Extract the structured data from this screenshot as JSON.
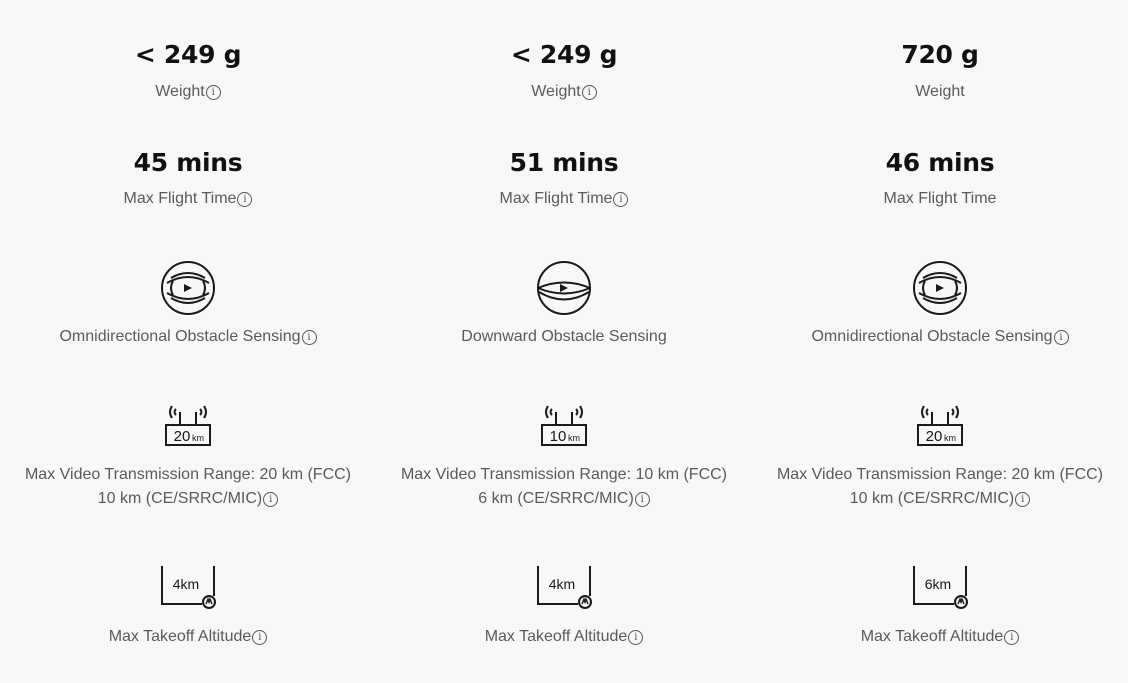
{
  "columns": [
    {
      "weight": {
        "value": "< 249 g",
        "label": "Weight",
        "info": true
      },
      "flight_time": {
        "value": "45 mins",
        "label": "Max Flight Time",
        "info": true
      },
      "obstacle_sensing": {
        "icon": "omnidirectional-sensing-icon",
        "label": "Omnidirectional Obstacle Sensing",
        "info": true
      },
      "video_transmission": {
        "icon": "transmission-20km-icon",
        "icon_text": "20",
        "icon_unit": "km",
        "line1": "Max Video Transmission Range: 20 km (FCC)",
        "line2": "10 km (CE/SRRC/MIC)",
        "info": true
      },
      "altitude": {
        "icon": "altitude-4km-icon",
        "icon_text": "4km",
        "label": "Max Takeoff Altitude",
        "info": true
      }
    },
    {
      "weight": {
        "value": "< 249 g",
        "label": "Weight",
        "info": true
      },
      "flight_time": {
        "value": "51 mins",
        "label": "Max Flight Time",
        "info": true
      },
      "obstacle_sensing": {
        "icon": "downward-sensing-icon",
        "label": "Downward Obstacle Sensing",
        "info": false
      },
      "video_transmission": {
        "icon": "transmission-10km-icon",
        "icon_text": "10",
        "icon_unit": "km",
        "line1": "Max Video Transmission Range: 10 km (FCC)",
        "line2": "6 km (CE/SRRC/MIC)",
        "info": true
      },
      "altitude": {
        "icon": "altitude-4km-icon",
        "icon_text": "4km",
        "label": "Max Takeoff Altitude",
        "info": true
      }
    },
    {
      "weight": {
        "value": "720 g",
        "label": "Weight",
        "info": false
      },
      "flight_time": {
        "value": "46 mins",
        "label": "Max Flight Time",
        "info": false
      },
      "obstacle_sensing": {
        "icon": "omnidirectional-sensing-icon",
        "label": "Omnidirectional Obstacle Sensing",
        "info": true
      },
      "video_transmission": {
        "icon": "transmission-20km-icon",
        "icon_text": "20",
        "icon_unit": "km",
        "line1": "Max Video Transmission Range: 20 km (FCC)",
        "line2": "10 km (CE/SRRC/MIC)",
        "info": true
      },
      "altitude": {
        "icon": "altitude-6km-icon",
        "icon_text": "6km",
        "label": "Max Takeoff Altitude",
        "info": true
      }
    }
  ],
  "info_glyph": "i",
  "colors": {
    "background": "#f7f7f7",
    "value_text": "#111111",
    "label_text": "#5a5a5a",
    "icon_stroke": "#1a1a1a"
  }
}
